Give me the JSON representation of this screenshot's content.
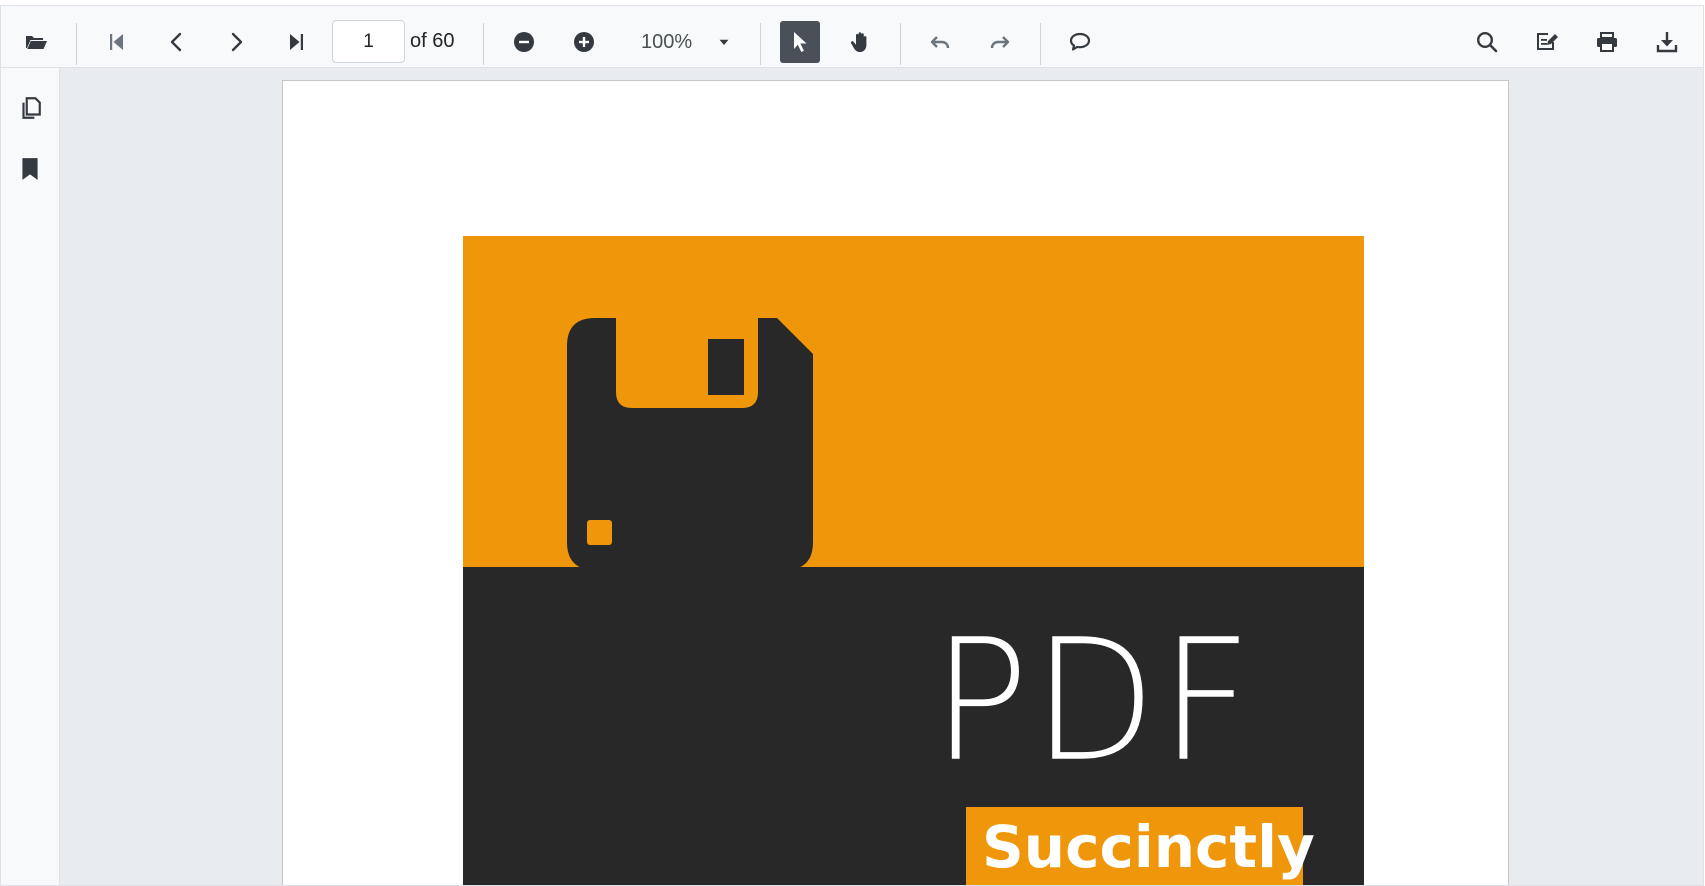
{
  "toolbar": {
    "page_number": "1",
    "page_total": "of 60",
    "zoom": "100%"
  },
  "icons": {
    "open": "folder-open-icon",
    "first": "first-page-icon",
    "prev": "previous-page-icon",
    "next": "next-page-icon",
    "last": "last-page-icon",
    "zoom_out": "zoom-out-icon",
    "zoom_in": "zoom-in-icon",
    "zoom_dropdown": "caret-down-icon",
    "select": "text-select-pointer-icon",
    "pan": "pan-hand-icon",
    "undo": "undo-icon",
    "redo": "redo-icon",
    "comment": "comment-icon",
    "search": "search-icon",
    "edit": "edit-annotation-icon",
    "print": "print-icon",
    "download": "download-icon",
    "thumbnails": "page-thumbnails-icon",
    "bookmarks": "bookmark-icon"
  },
  "colors": {
    "toolbar_bg": "#f8f9fa",
    "icon": "#495057",
    "active_tool": "#495057",
    "viewer_bg": "#e9ecef",
    "cover_orange": "#f0960a",
    "cover_dark": "#282828"
  },
  "document": {
    "cover_title": "PDF",
    "cover_tag": "Succinctly"
  }
}
